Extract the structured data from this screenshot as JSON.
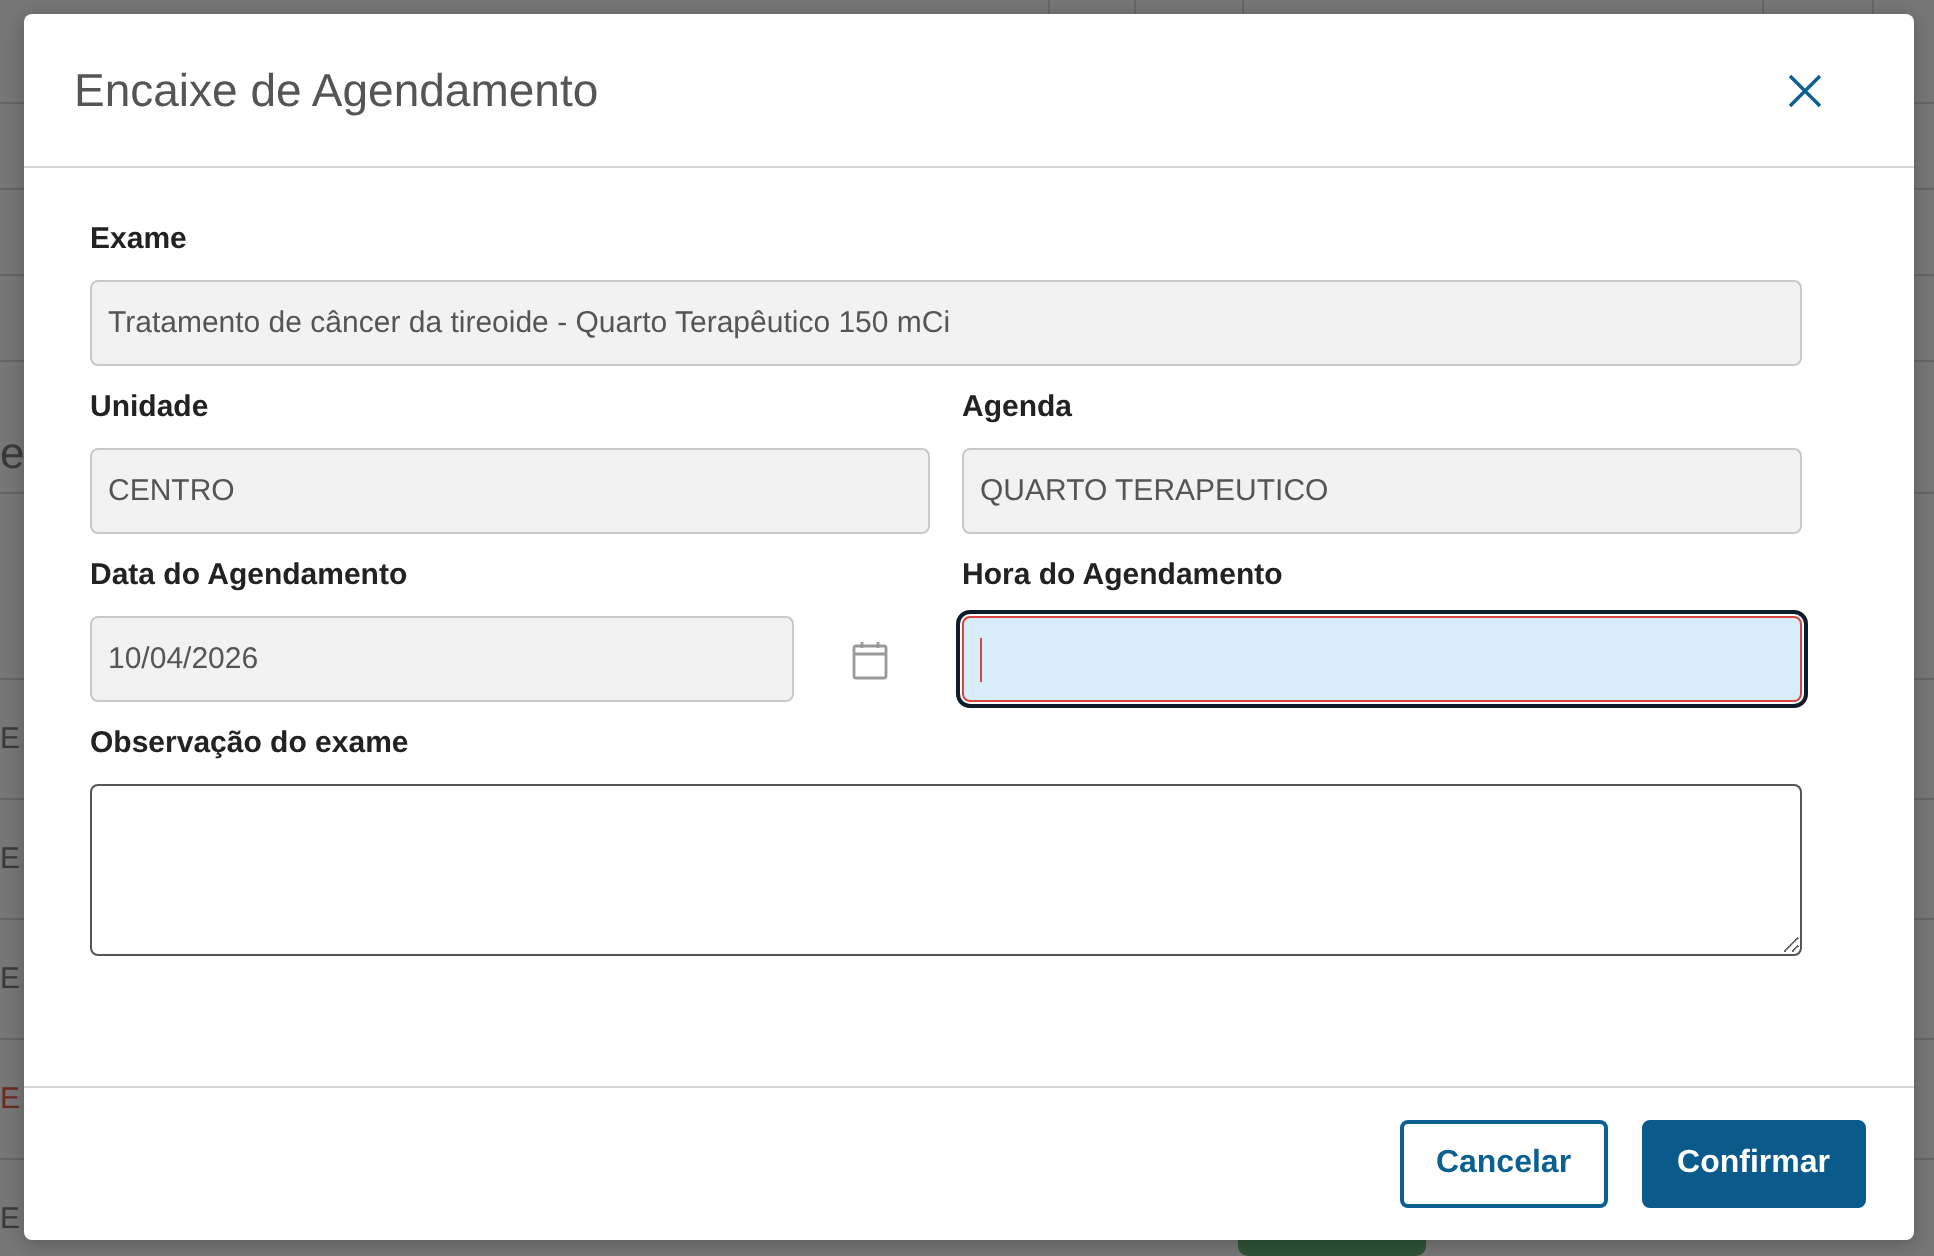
{
  "background": {
    "text": "e",
    "rows": [
      {
        "text": "E",
        "color": "#3a3a3a"
      },
      {
        "text": "E",
        "color": "#3a3a3a"
      },
      {
        "text": "E",
        "color": "#3a3a3a"
      },
      {
        "text": "E",
        "color": "#6b2b22"
      },
      {
        "text": "E",
        "color": "#3a3a3a"
      }
    ]
  },
  "dialog": {
    "title": "Encaixe de Agendamento",
    "rows": [
      {
        "fields": [
          {
            "kind": "text",
            "label": "Exame",
            "value": "Tratamento de câncer da tireoide - Quarto Terapêutico 150 mCi",
            "disabled": true,
            "focused": false,
            "invalid": false
          }
        ]
      },
      {
        "fields": [
          {
            "kind": "text",
            "label": "Unidade",
            "value": "CENTRO",
            "disabled": true,
            "focused": false,
            "invalid": false
          },
          {
            "kind": "text",
            "label": "Agenda",
            "value": "QUARTO TERAPEUTICO",
            "disabled": true,
            "focused": false,
            "invalid": false
          }
        ]
      },
      {
        "fields": [
          {
            "kind": "date",
            "label": "Data do Agendamento",
            "value": "10/04/2026",
            "disabled": true,
            "focused": false,
            "invalid": false
          },
          {
            "kind": "text",
            "label": "Hora do Agendamento",
            "disabled": false,
            "focused": true,
            "invalid": true
          }
        ]
      },
      {
        "fields": [
          {
            "kind": "textarea",
            "label": "Observação do exame",
            "disabled": false,
            "focused": false,
            "invalid": false
          }
        ]
      }
    ],
    "buttons": [
      {
        "kind": "outline",
        "label": "Cancelar"
      },
      {
        "kind": "primary",
        "label": "Confirmar"
      }
    ]
  }
}
